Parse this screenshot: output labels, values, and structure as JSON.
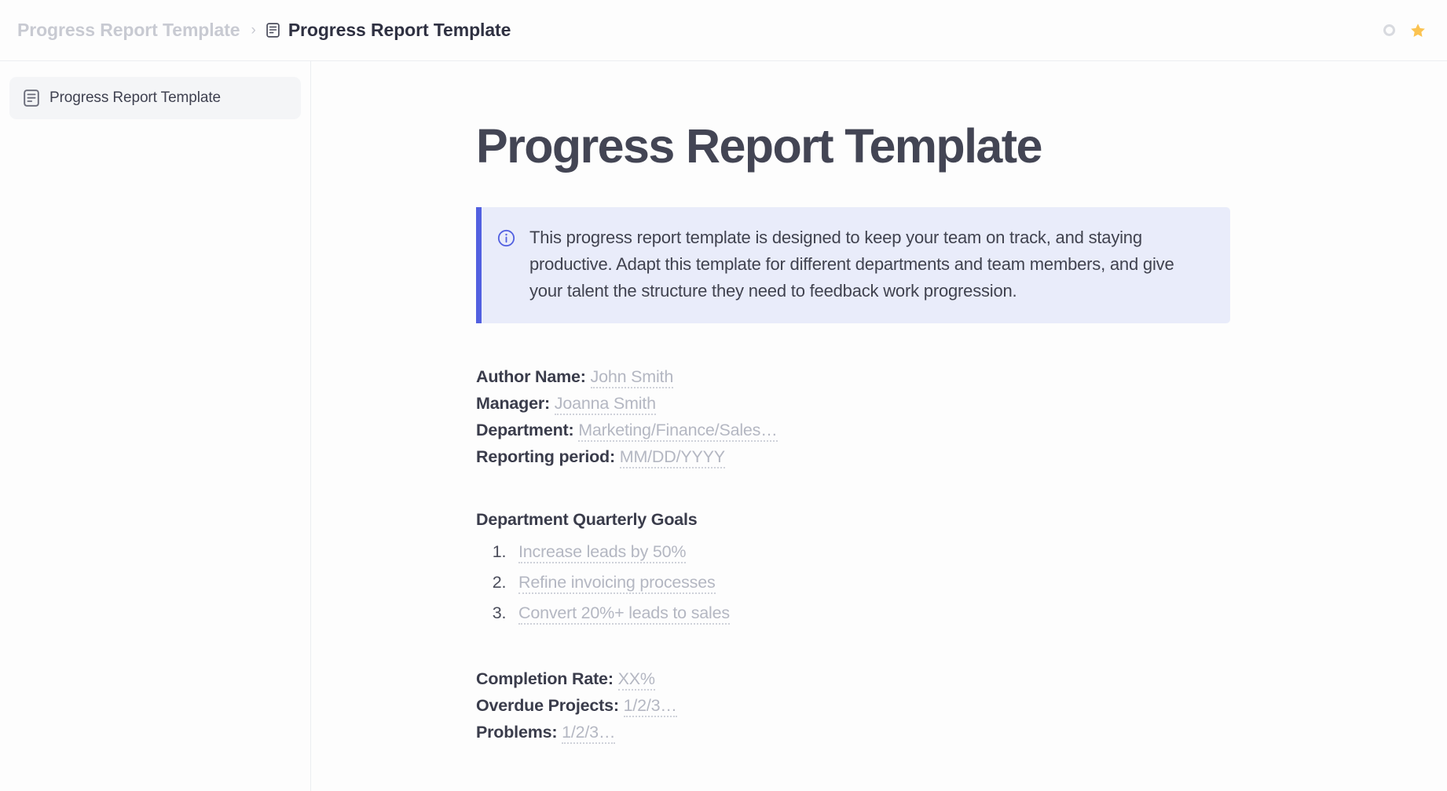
{
  "header": {
    "breadcrumb": {
      "root_label": "Progress Report Template",
      "separator": "›",
      "current_label": "Progress Report Template",
      "current_icon": "document-icon"
    },
    "actions": [
      {
        "icon": "circle-ring-icon",
        "color": "#d8dadf"
      },
      {
        "icon": "star-icon",
        "color": "#fbc351"
      }
    ]
  },
  "sidebar": {
    "items": [
      {
        "label": "Progress Report Template",
        "icon": "document-icon",
        "selected": true
      }
    ]
  },
  "document": {
    "title": "Progress Report Template",
    "callout": {
      "icon": "info-circle-icon",
      "accent_color": "#5260e0",
      "background_color": "#e9ecfa",
      "text": "This progress report template is designed to keep your team on track, and staying productive. Adapt this template for different departments and team members, and give your talent the structure they need to feedback work progression."
    },
    "fields": [
      {
        "label": "Author Name:",
        "placeholder": "John Smith"
      },
      {
        "label": "Manager:",
        "placeholder": "Joanna Smith"
      },
      {
        "label": "Department:",
        "placeholder": "Marketing/Finance/Sales…"
      },
      {
        "label": "Reporting period:",
        "placeholder": "MM/DD/YYYY"
      }
    ],
    "goals_section": {
      "heading": "Department Quarterly Goals",
      "items": [
        "Increase leads by 50%",
        "Refine invoicing processes",
        "Convert 20%+ leads to sales"
      ]
    },
    "metrics": [
      {
        "label": "Completion Rate:",
        "placeholder": "XX%"
      },
      {
        "label": "Overdue Projects:",
        "placeholder": "1/2/3…"
      },
      {
        "label": "Problems:",
        "placeholder": "1/2/3…"
      }
    ]
  }
}
